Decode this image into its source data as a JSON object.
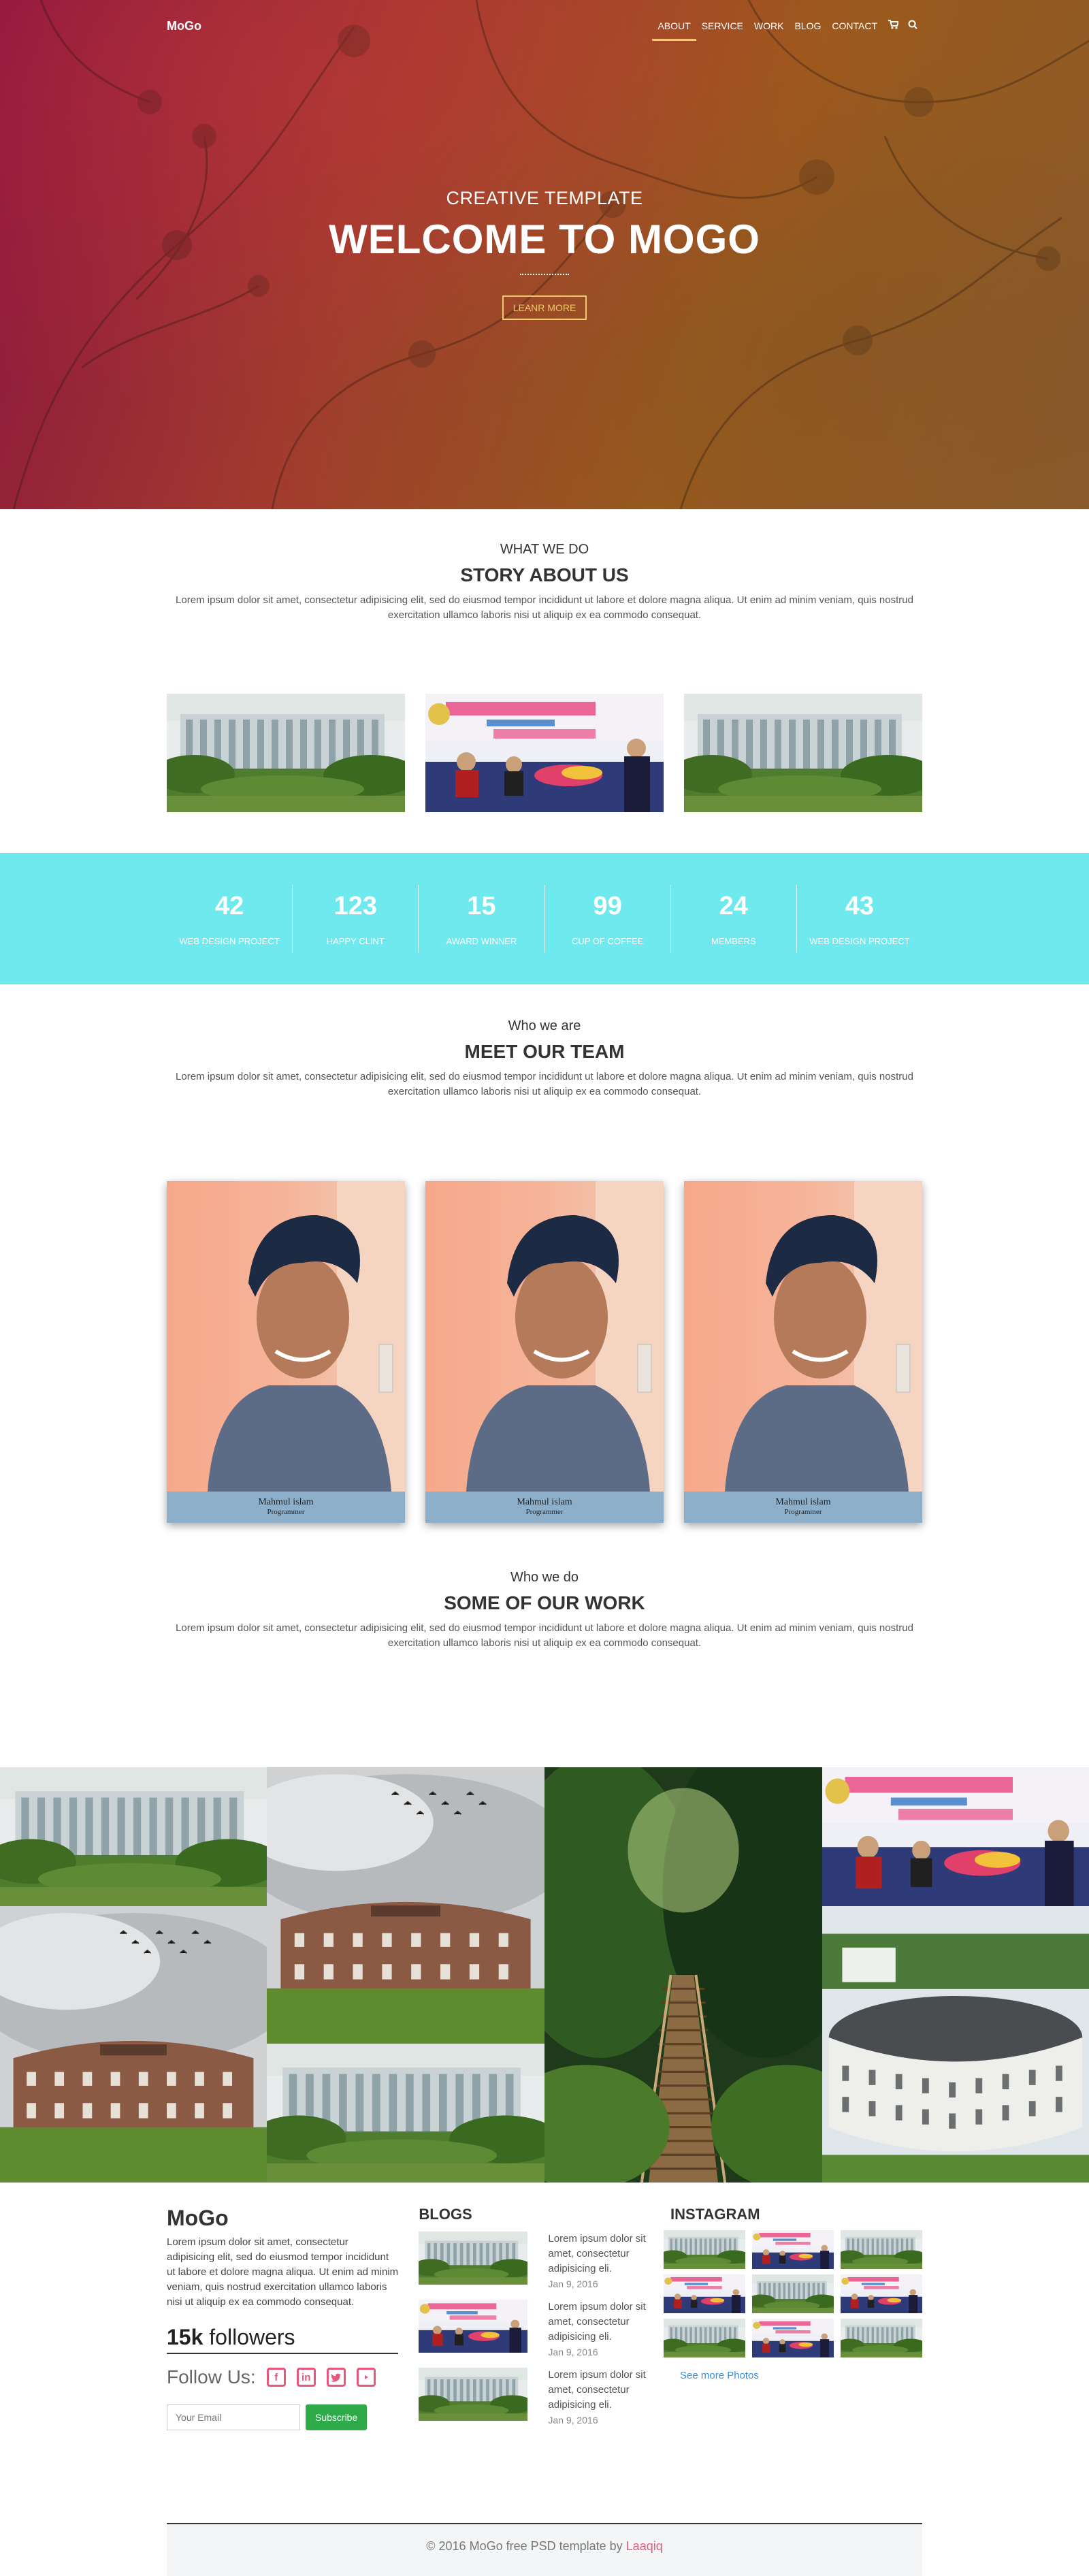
{
  "nav": {
    "logo": "MoGo",
    "items": [
      "ABOUT",
      "SERVICE",
      "WORK",
      "BLOG",
      "CONTACT"
    ],
    "cart_icon": "cart-icon",
    "search_icon": "search-icon"
  },
  "hero": {
    "subtitle": "CREATIVE TEMPLATE",
    "title": "WELCOME TO MOGO",
    "button": "LEANR MORE"
  },
  "story": {
    "small": "WHAT WE DO",
    "title": "STORY ABOUT US",
    "text": "Lorem ipsum dolor sit amet, consectetur adipisicing elit, sed do eiusmod tempor incididunt ut labore et dolore magna aliqua. Ut enim ad minim veniam, quis nostrud exercitation ullamco laboris nisi ut aliquip ex ea commodo consequat."
  },
  "stats": [
    {
      "num": "42",
      "label": "WEB DESIGN PROJECT"
    },
    {
      "num": "123",
      "label": "HAPPY CLINT"
    },
    {
      "num": "15",
      "label": "AWARD WINNER"
    },
    {
      "num": "99",
      "label": "CUP OF COFFEE"
    },
    {
      "num": "24",
      "label": "MEMBERS"
    },
    {
      "num": "43",
      "label": "WEB DESIGN PROJECT"
    }
  ],
  "team": {
    "small": "Who we are",
    "title": "MEET OUR TEAM",
    "text": "Lorem ipsum dolor sit amet, consectetur adipisicing elit, sed do eiusmod tempor incididunt ut labore et dolore magna aliqua. Ut enim ad minim veniam, quis nostrud exercitation ullamco laboris nisi ut aliquip ex ea commodo consequat.",
    "members": [
      {
        "name": "Mahmul islam",
        "role": "Programmer"
      },
      {
        "name": "Mahmul islam",
        "role": "Programmer"
      },
      {
        "name": "Mahmul islam",
        "role": "Programmer"
      }
    ]
  },
  "work": {
    "small": "Who we do",
    "title": "SOME OF OUR WORK",
    "text": "Lorem ipsum dolor sit amet, consectetur adipisicing elit, sed do eiusmod tempor incididunt ut labore et dolore magna aliqua. Ut enim ad minim veniam, quis nostrud exercitation ullamco laboris nisi ut aliquip ex ea commodo consequat."
  },
  "footer": {
    "brand": "MoGo",
    "about": "Lorem ipsum dolor sit amet, consectetur adipisicing elit, sed do eiusmod tempor incididunt ut labore et dolore magna aliqua. Ut enim ad minim veniam, quis nostrud exercitation ullamco laboris nisi ut aliquip ex ea commodo consequat.",
    "followers_count": "15k",
    "followers_label": " followers",
    "follow_us": "Follow Us:",
    "email_placeholder": "Your Email",
    "subscribe": "Subscribe",
    "blogs_title": "BLOGS",
    "blogs": [
      {
        "text": "Lorem ipsum dolor sit amet, consectetur adipisicing eli.",
        "date": "Jan 9, 2016"
      },
      {
        "text": "Lorem ipsum dolor sit amet, consectetur adipisicing eli.",
        "date": "Jan 9, 2016"
      },
      {
        "text": "Lorem ipsum dolor sit amet, consectetur adipisicing eli.",
        "date": "Jan 9, 2016"
      }
    ],
    "instagram_title": "INSTAGRAM",
    "see_more": "See more Photos",
    "copyright": "© 2016 MoGo free PSD template by ",
    "copyright_link": "Laaqiq"
  },
  "colors": {
    "stats_bg": "#6ee9ee",
    "accent": "#f3c96b",
    "social": "#e9577b",
    "subscribe_btn": "#2eaa4a"
  }
}
